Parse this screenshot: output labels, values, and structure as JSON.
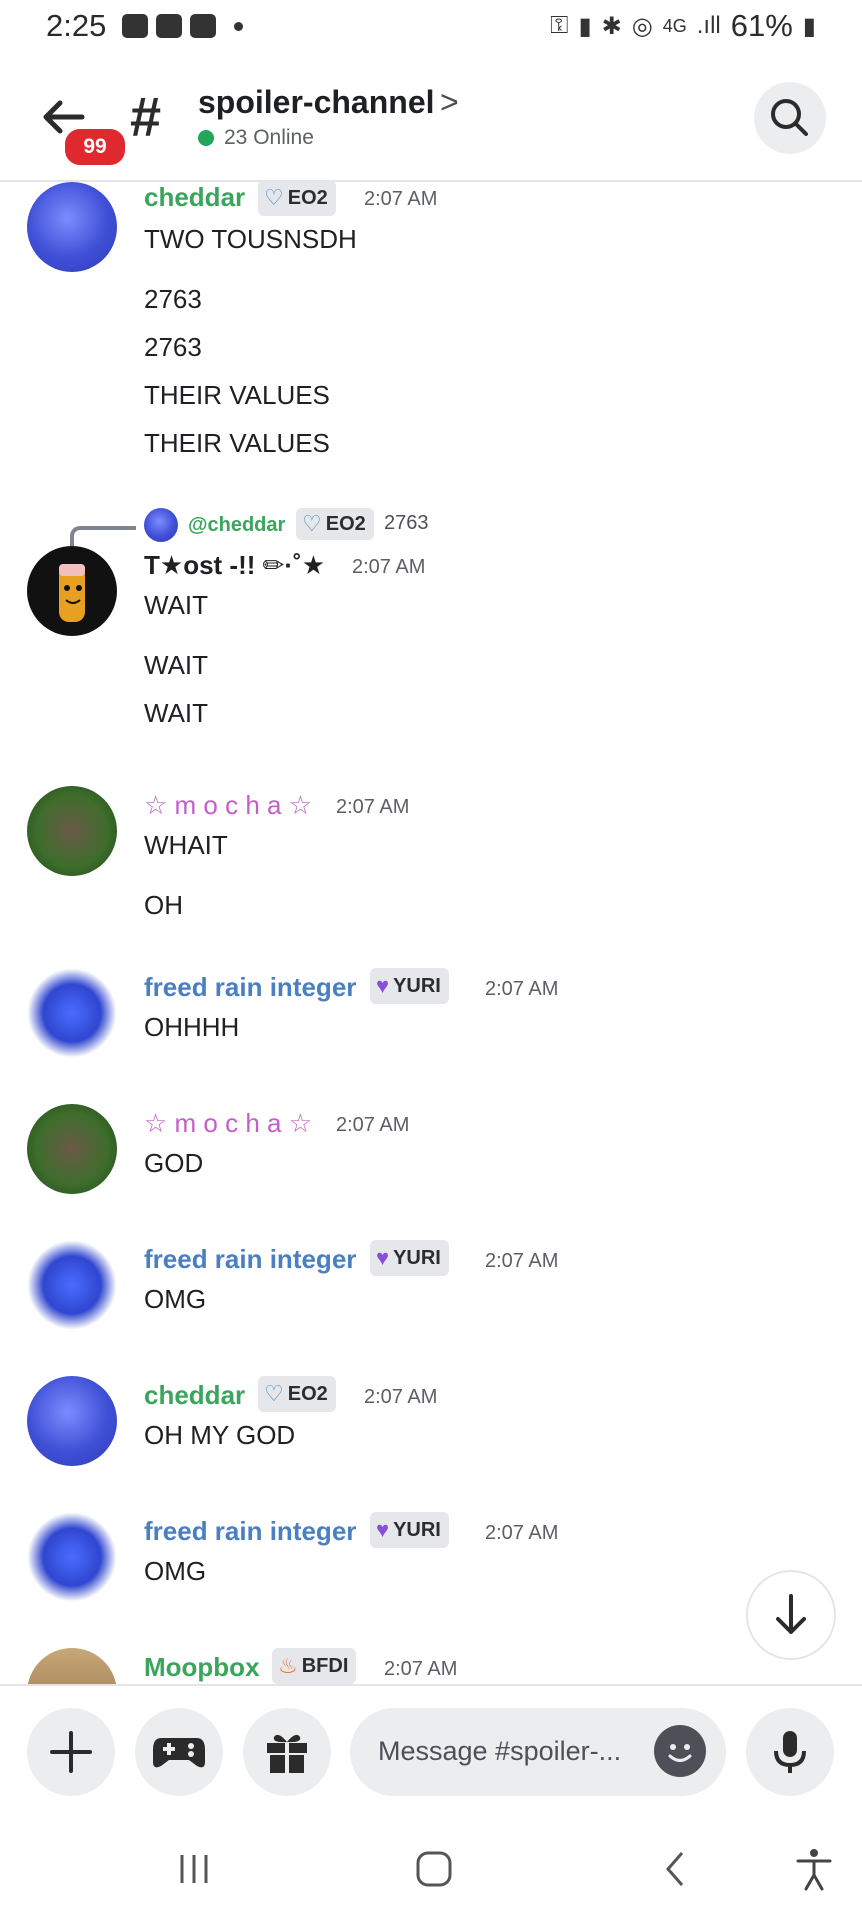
{
  "status_bar": {
    "time": "2:25",
    "battery": "61%",
    "network": "4G"
  },
  "header": {
    "badge": "99",
    "hash": "#",
    "channel_name": "spoiler-channel",
    "chevron": ">",
    "online": "23 Online"
  },
  "messages": [
    {
      "user": "cheddar",
      "tag": "EO2",
      "time": "2:07 AM",
      "color": "#3ba55d",
      "lines": [
        "TWO TOUSNSDH",
        "2763",
        "2763",
        "THEIR VALUES",
        "THEIR VALUES"
      ]
    },
    {
      "reply": {
        "user": "@cheddar",
        "tag": "EO2",
        "text": "2763"
      },
      "user": "T★ost -!! ✏·˚★",
      "time": "2:07 AM",
      "color": "#1f2023",
      "lines": [
        "WAIT",
        "WAIT",
        "WAIT"
      ]
    },
    {
      "user": "☆ m o c h a ☆",
      "time": "2:07 AM",
      "color": "#c35fc8",
      "lines": [
        "WHAIT",
        "OH"
      ]
    },
    {
      "user": "freed rain integer",
      "tag": "YURI",
      "time": "2:07 AM",
      "color": "#4a7fc1",
      "lines": [
        "OHHHH"
      ]
    },
    {
      "user": "☆ m o c h a ☆",
      "time": "2:07 AM",
      "color": "#c35fc8",
      "lines": [
        "GOD"
      ]
    },
    {
      "user": "freed rain integer",
      "tag": "YURI",
      "time": "2:07 AM",
      "color": "#4a7fc1",
      "lines": [
        "OMG"
      ]
    },
    {
      "user": "cheddar",
      "tag": "EO2",
      "time": "2:07 AM",
      "color": "#3ba55d",
      "lines": [
        "OH MY GOD"
      ]
    },
    {
      "user": "freed rain integer",
      "tag": "YURI",
      "time": "2:07 AM",
      "color": "#4a7fc1",
      "lines": [
        "OMG"
      ]
    },
    {
      "user": "Moopbox",
      "tag": "BFDI",
      "time": "2:07 AM",
      "color": "#3ba55d",
      "lines": []
    }
  ],
  "composer": {
    "placeholder": "Message #spoiler-..."
  },
  "icons": {
    "back": "arrow-left-icon",
    "search": "search-icon",
    "add": "plus-icon",
    "games": "gamepad-icon",
    "gift": "gift-icon",
    "emoji": "emoji-icon",
    "mic": "mic-icon",
    "scroll": "arrow-down-icon"
  }
}
